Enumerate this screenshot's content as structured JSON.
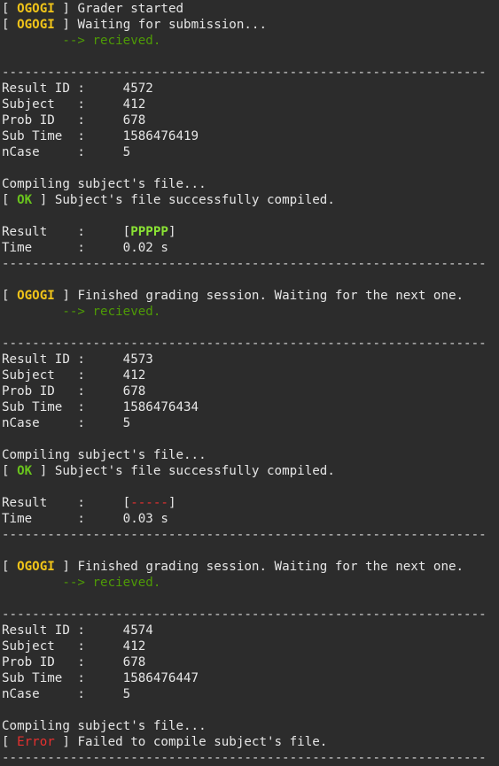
{
  "header": {
    "tag_ogogi": "OGOGI",
    "grader_started": " Grader started",
    "waiting": " Waiting for submission...",
    "received": "        --> recieved."
  },
  "separator": "----------------------------------------------------------------",
  "labels": {
    "result_id": "Result ID :     ",
    "subject": "Subject   :     ",
    "prob_id": "Prob ID   :     ",
    "sub_time": "Sub Time  :     ",
    "ncase": "nCase     :     ",
    "result": "Result    :     ",
    "time": "Time      :     "
  },
  "messages": {
    "compiling": "Compiling subject's file...",
    "tag_ok": "OK",
    "compiled_ok": " Subject's file successfully compiled.",
    "finished": " Finished grading session. Waiting for the next one.",
    "tag_error": "Error",
    "compile_failed": " Failed to compile subject's file."
  },
  "submissions": [
    {
      "result_id": "4572",
      "subject": "412",
      "prob_id": "678",
      "sub_time": "1586476419",
      "ncase": "5",
      "result": "PPPPP",
      "time": "0.02 s"
    },
    {
      "result_id": "4573",
      "subject": "412",
      "prob_id": "678",
      "sub_time": "1586476434",
      "ncase": "5",
      "result": "-----",
      "time": "0.03 s"
    },
    {
      "result_id": "4574",
      "subject": "412",
      "prob_id": "678",
      "sub_time": "1586476447",
      "ncase": "5"
    }
  ],
  "colors": {
    "background": "#2c2c2c",
    "text": "#e6e6e6",
    "ogogi": "#f0c419",
    "ok": "#69c31d",
    "error": "#e8302f",
    "received": "#4e9a06",
    "pass": "#8ae234"
  }
}
